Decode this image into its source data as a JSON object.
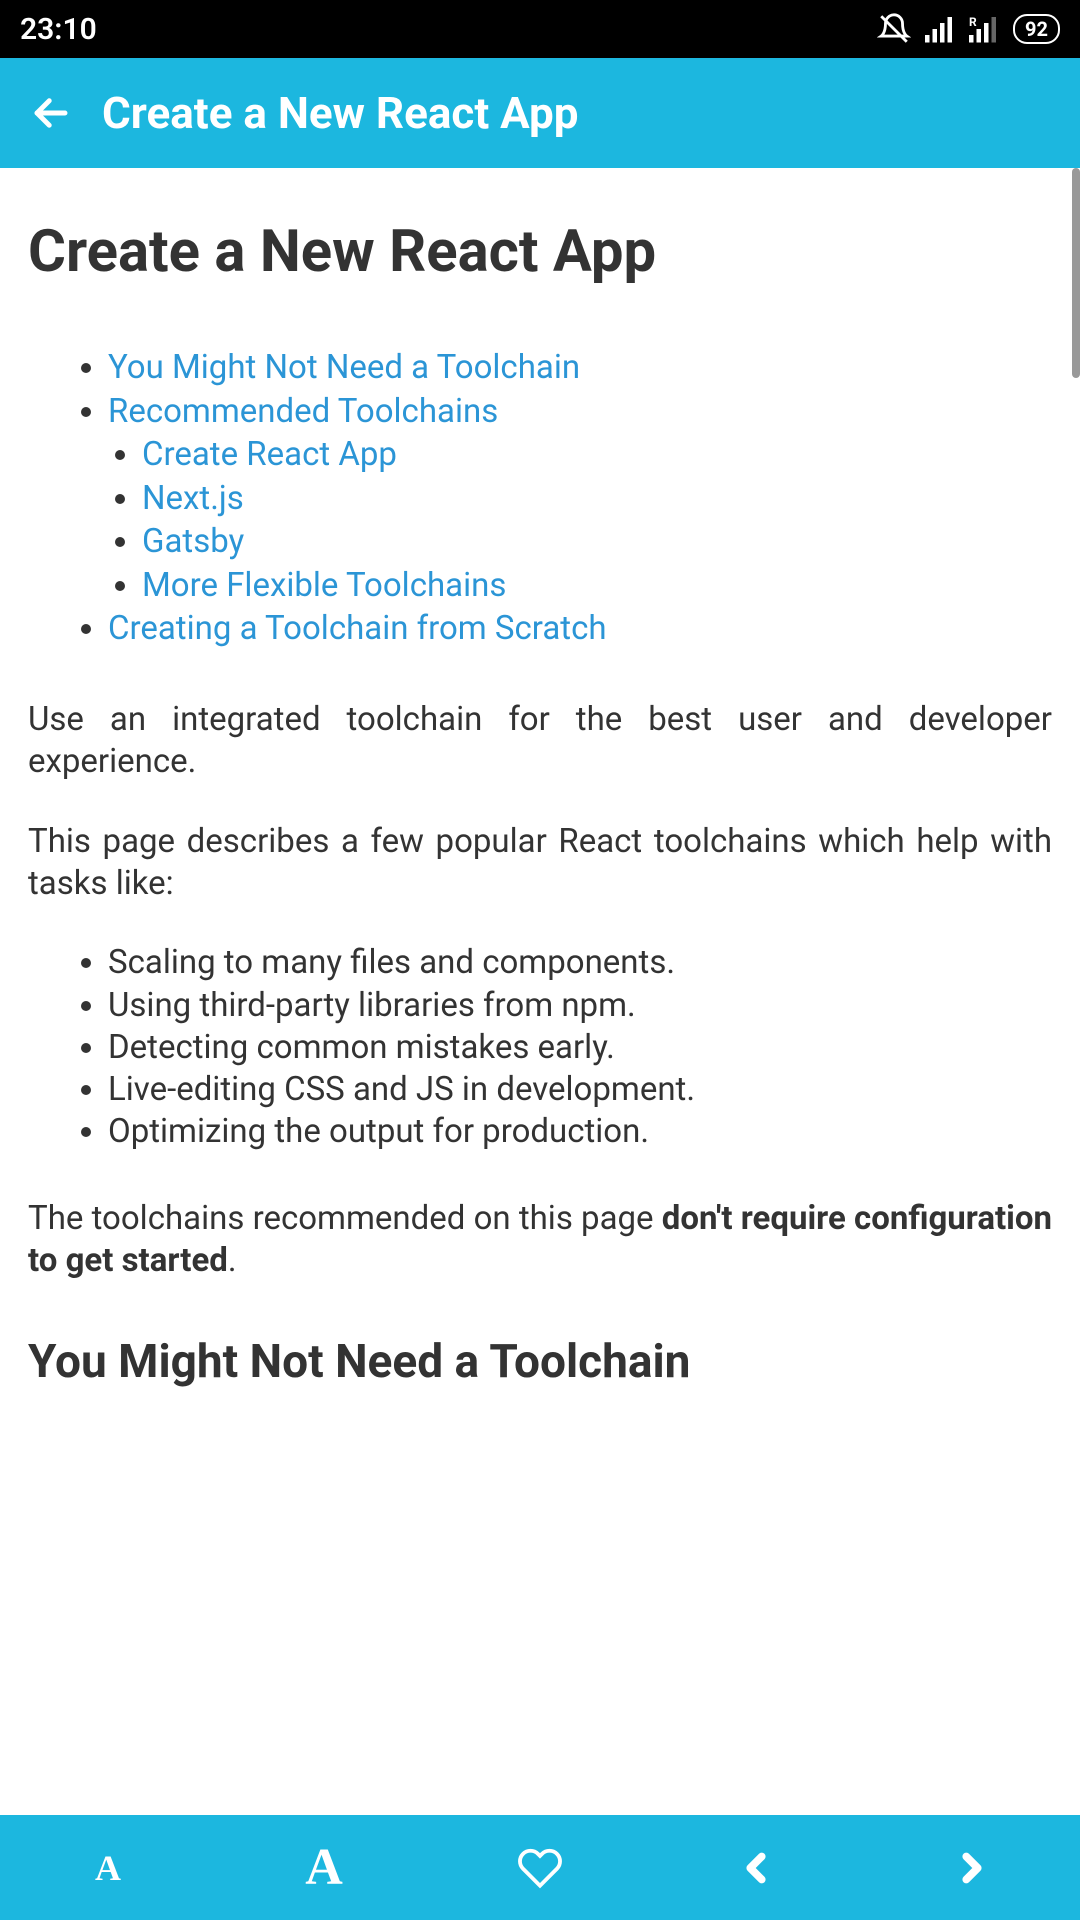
{
  "statusBar": {
    "time": "23:10",
    "battery": "92"
  },
  "header": {
    "title": "Create a New React App"
  },
  "content": {
    "pageTitle": "Create a New React App",
    "toc": [
      {
        "label": "You Might Not Need a Toolchain"
      },
      {
        "label": "Recommended Toolchains",
        "children": [
          {
            "label": "Create React App"
          },
          {
            "label": "Next.js"
          },
          {
            "label": "Gatsby"
          },
          {
            "label": "More Flexible Toolchains"
          }
        ]
      },
      {
        "label": "Creating a Toolchain from Scratch"
      }
    ],
    "para1": "Use an integrated toolchain for the best user and developer experience.",
    "para2": "This page describes a few popular React toolchains which help with tasks like:",
    "tasks": [
      "Scaling to many files and components.",
      "Using third-party libraries from npm.",
      "Detecting common mistakes early.",
      "Live-editing CSS and JS in development.",
      "Optimizing the output for production."
    ],
    "para3a": "The toolchains recommended on this page ",
    "para3b": "don't require configuration to get started",
    "para3c": ".",
    "section1": "You Might Not Need a Toolchain"
  },
  "bottomBar": {
    "fontGlyph": "A"
  }
}
